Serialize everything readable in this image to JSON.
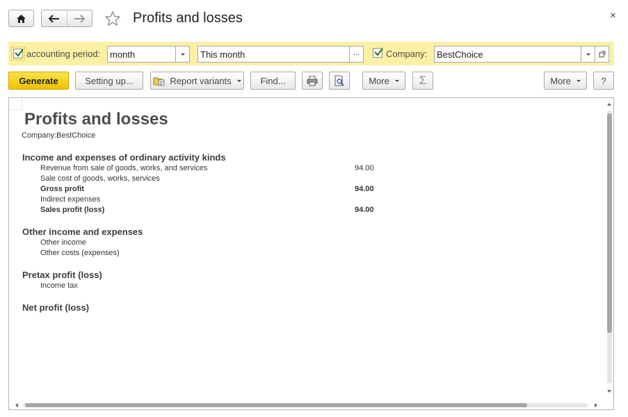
{
  "window": {
    "title": "Profits and losses",
    "close_symbol": "×",
    "icons": {
      "home": "home-icon",
      "back": "arrow-left-icon",
      "forward": "arrow-right-icon",
      "favorite": "star-icon"
    }
  },
  "filters": {
    "period_checked": true,
    "period_label": "accounting period:",
    "period_type": "month",
    "period_value": "This month",
    "period_more": "...",
    "company_checked": true,
    "company_label": "Company:",
    "company_value": "BestChoice"
  },
  "toolbar": {
    "generate": "Generate",
    "setting_up": "Setting up...",
    "report_variants": "Report variants",
    "find": "Find...",
    "more1": "More",
    "sum_symbol": "Σ",
    "more2": "More",
    "help": "?"
  },
  "report": {
    "title": "Profits and losses",
    "company_line": "Company:BestChoice",
    "sections": [
      {
        "heading": "Income and expenses of ordinary activity kinds",
        "lines": [
          {
            "label": "Revenue from sale of goods, works, and services",
            "amount": "94.00",
            "bold": false
          },
          {
            "label": "Sale cost of goods, works, services",
            "amount": "",
            "bold": false
          },
          {
            "label": "Gross profit",
            "amount": "94.00",
            "bold": true
          },
          {
            "label": "Indirect expenses",
            "amount": "",
            "bold": false
          },
          {
            "label": "Sales profit (loss)",
            "amount": "94.00",
            "bold": true
          }
        ]
      },
      {
        "heading": "Other income and expenses",
        "lines": [
          {
            "label": "Other income",
            "amount": "",
            "bold": false
          },
          {
            "label": "Other costs (expenses)",
            "amount": "",
            "bold": false
          }
        ]
      },
      {
        "heading": "Pretax profit (loss)",
        "lines": [
          {
            "label": "Income tax",
            "amount": "",
            "bold": false
          }
        ]
      },
      {
        "heading": "Net profit (loss)",
        "lines": []
      }
    ]
  },
  "colors": {
    "filter_bg": "#fcf0a5",
    "primary_button": "#f5cc0f",
    "title_text": "#222222"
  }
}
